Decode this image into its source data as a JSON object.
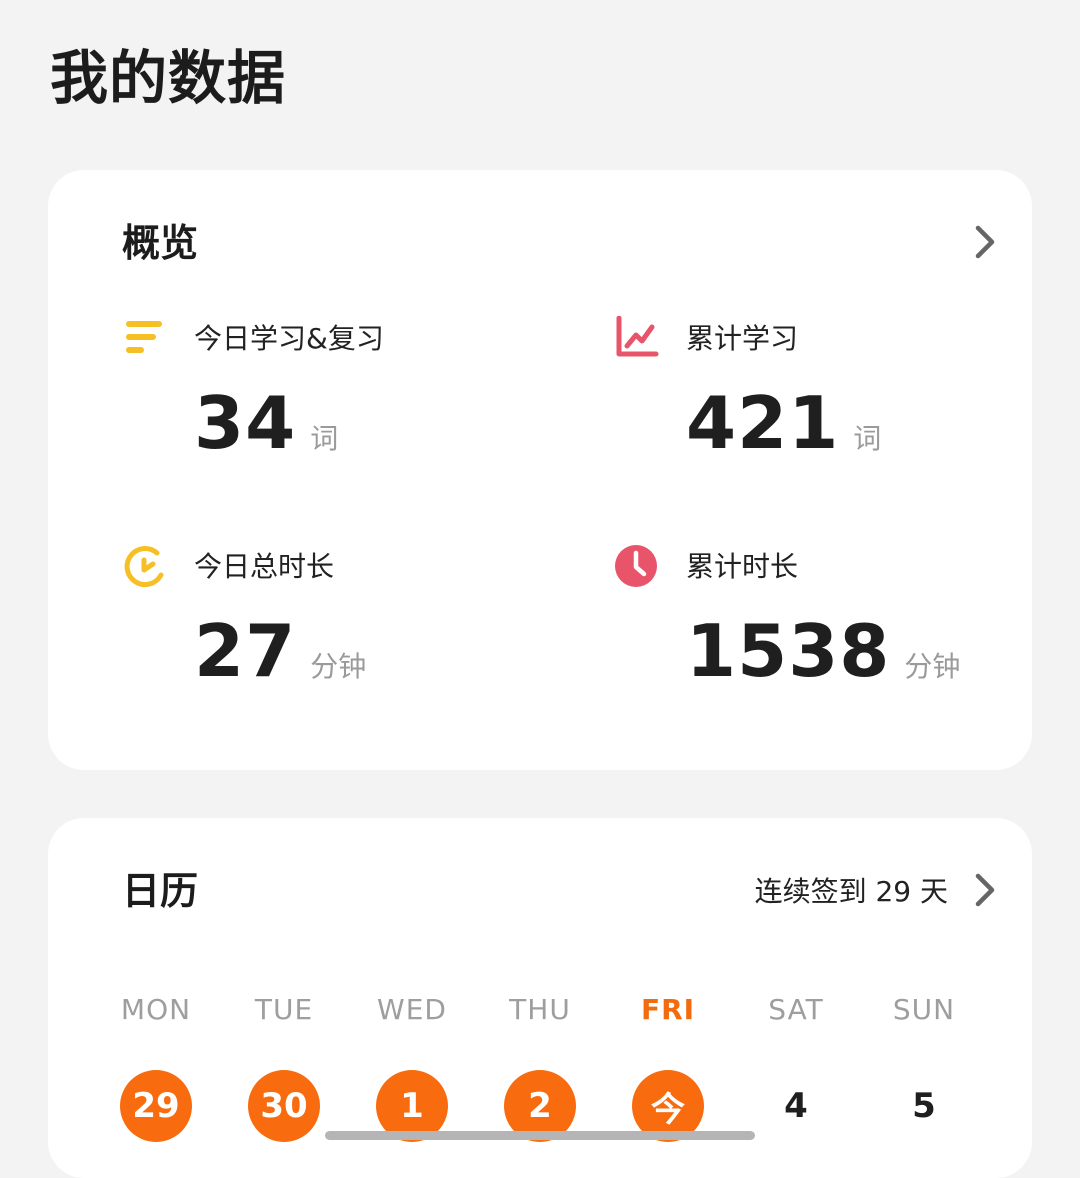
{
  "page": {
    "title": "我的数据"
  },
  "overview": {
    "title": "概览",
    "stats": [
      {
        "label": "今日学习&复习",
        "value": "34",
        "unit": "词",
        "icon": "lines-icon",
        "icon_color": "#f6c025"
      },
      {
        "label": "累计学习",
        "value": "421",
        "unit": "词",
        "icon": "line-chart-icon",
        "icon_color": "#e8546a"
      },
      {
        "label": "今日总时长",
        "value": "27",
        "unit": "分钟",
        "icon": "progress-ring-icon",
        "icon_color": "#f6c025"
      },
      {
        "label": "累计时长",
        "value": "1538",
        "unit": "分钟",
        "icon": "clock-icon",
        "icon_color": "#e8546a"
      }
    ]
  },
  "calendar": {
    "title": "日历",
    "streak_text": "连续签到 29 天",
    "weekdays": [
      "MON",
      "TUE",
      "WED",
      "THU",
      "FRI",
      "SAT",
      "SUN"
    ],
    "active_weekday": "FRI",
    "dates": [
      {
        "label": "29",
        "checked": true
      },
      {
        "label": "30",
        "checked": true
      },
      {
        "label": "1",
        "checked": true
      },
      {
        "label": "2",
        "checked": true
      },
      {
        "label": "今",
        "checked": true
      },
      {
        "label": "4",
        "checked": false
      },
      {
        "label": "5",
        "checked": false
      }
    ]
  },
  "colors": {
    "accent_orange": "#f86b0e",
    "yellow": "#f6c025",
    "red": "#e8546a",
    "background": "#f3f3f3"
  }
}
